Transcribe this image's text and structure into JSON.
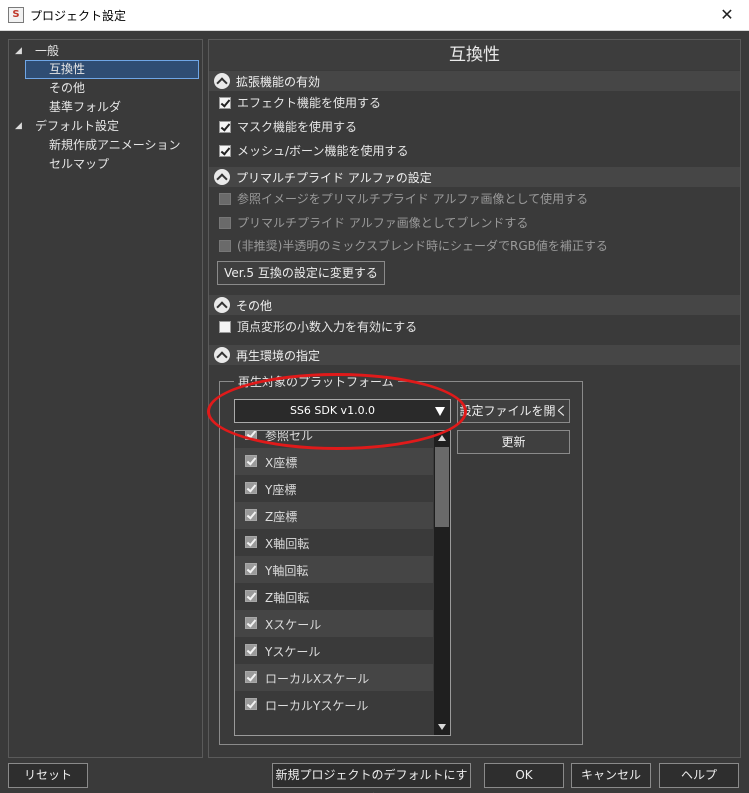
{
  "window": {
    "app_icon": "S",
    "title": "プロジェクト設定",
    "close_glyph": "✕"
  },
  "sidebar": {
    "items": [
      {
        "label": "一般",
        "expanded": true
      },
      {
        "label": "互換性",
        "selected": true
      },
      {
        "label": "その他"
      },
      {
        "label": "基準フォルダ"
      },
      {
        "label": "デフォルト設定",
        "expanded": true
      },
      {
        "label": "新規作成アニメーション"
      },
      {
        "label": "セルマップ"
      }
    ]
  },
  "panel": {
    "title": "互換性",
    "sections": {
      "extensions": {
        "title": "拡張機能の有効",
        "options": [
          {
            "label": "エフェクト機能を使用する",
            "checked": true
          },
          {
            "label": "マスク機能を使用する",
            "checked": true
          },
          {
            "label": "メッシュ/ボーン機能を使用する",
            "checked": true
          }
        ]
      },
      "premultiplied": {
        "title": "プリマルチプライド アルファの設定",
        "options": [
          {
            "label": "参照イメージをプリマルチプライド アルファ画像として使用する",
            "checked": false,
            "disabled": true
          },
          {
            "label": "プリマルチプライド アルファ画像としてブレンドする",
            "checked": false,
            "disabled": true
          },
          {
            "label": "(非推奨)半透明のミックスブレンド時にシェーダでRGB値を補正する",
            "checked": false,
            "disabled": true
          }
        ],
        "ver5_button": "Ver.5 互換の設定に変更する"
      },
      "other": {
        "title": "その他",
        "options": [
          {
            "label": "頂点変形の小数入力を有効にする",
            "checked": false
          }
        ]
      },
      "playback": {
        "title": "再生環境の指定",
        "group_label": "再生対象のプラットフォーム",
        "platform_selected": "SS6 SDK v1.0.0",
        "open_settings_button": "設定ファイルを開く",
        "update_button": "更新",
        "attributes": [
          {
            "label": "参照セル",
            "checked": true
          },
          {
            "label": "X座標",
            "checked": true
          },
          {
            "label": "Y座標",
            "checked": true
          },
          {
            "label": "Z座標",
            "checked": true
          },
          {
            "label": "X軸回転",
            "checked": true
          },
          {
            "label": "Y軸回転",
            "checked": true
          },
          {
            "label": "Z軸回転",
            "checked": true
          },
          {
            "label": "Xスケール",
            "checked": true
          },
          {
            "label": "Yスケール",
            "checked": true
          },
          {
            "label": "ローカルXスケール",
            "checked": true
          },
          {
            "label": "ローカルYスケール",
            "checked": true
          }
        ]
      }
    }
  },
  "footer": {
    "reset": "リセット",
    "set_default": "新規プロジェクトのデフォルトにする",
    "ok": "OK",
    "cancel": "キャンセル",
    "help": "ヘルプ"
  },
  "colors": {
    "annotation": "#e01a1a",
    "selection": "#2f4d73",
    "background": "#3a3a3a"
  }
}
